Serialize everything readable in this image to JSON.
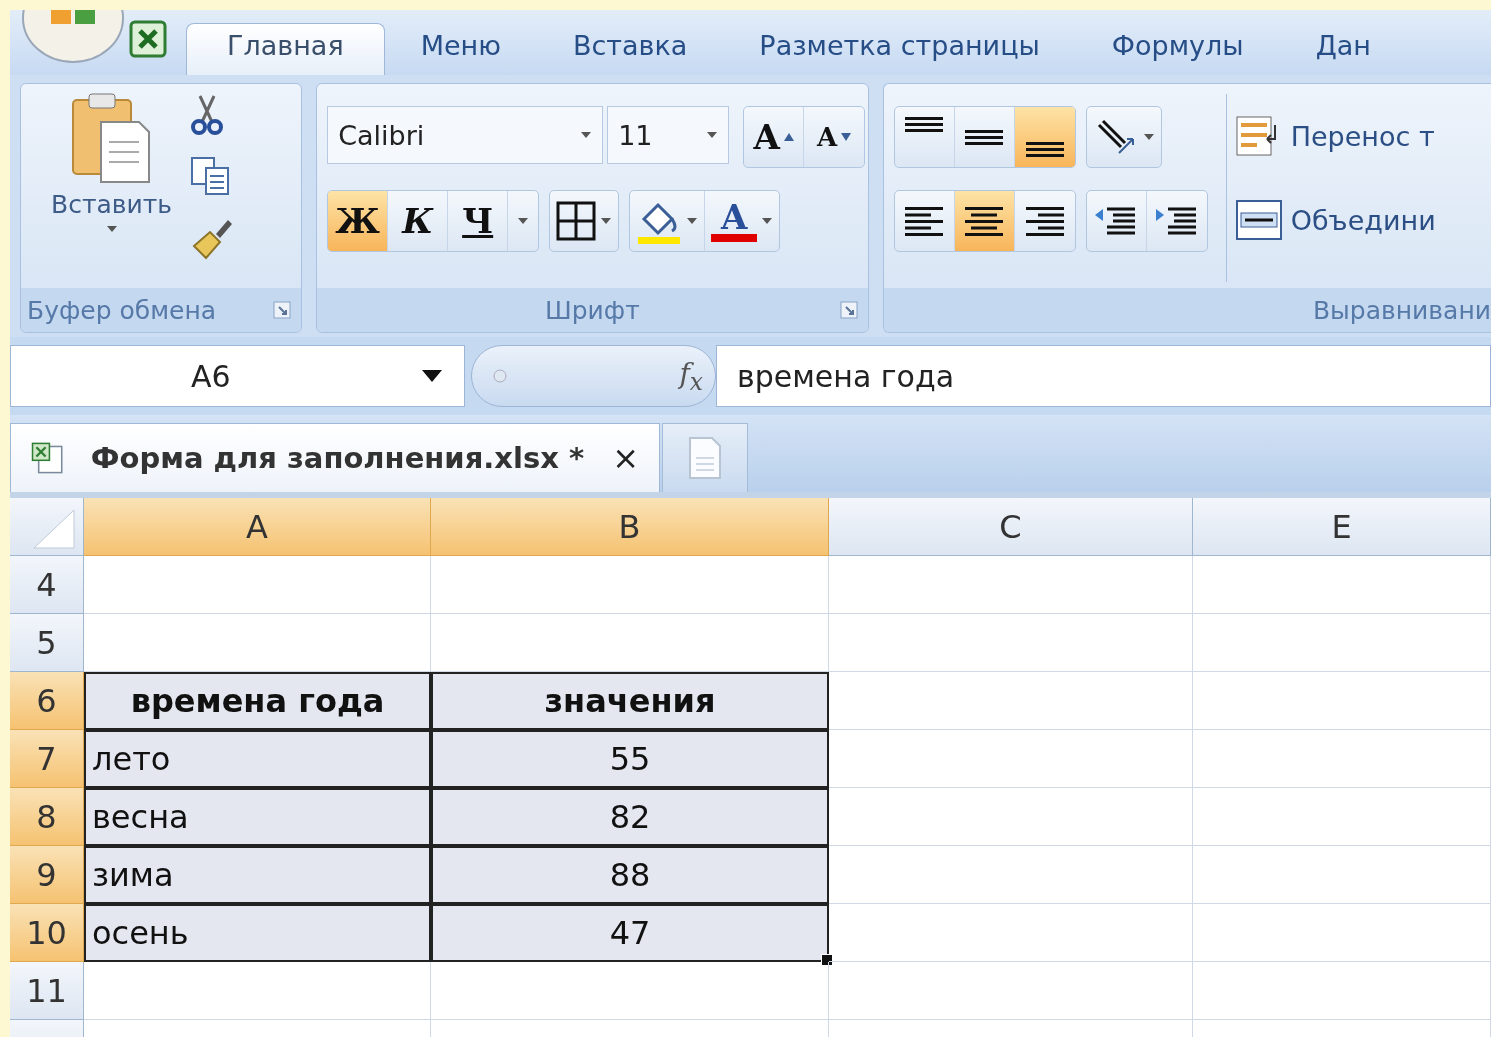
{
  "tabs": [
    {
      "label": "Главная",
      "selected": true
    },
    {
      "label": "Меню",
      "selected": false
    },
    {
      "label": "Вставка",
      "selected": false
    },
    {
      "label": "Разметка страницы",
      "selected": false
    },
    {
      "label": "Формулы",
      "selected": false
    },
    {
      "label": "Дан",
      "selected": false
    }
  ],
  "clipboard": {
    "paste_label": "Вставить",
    "group_label": "Буфер обмена"
  },
  "font": {
    "font_name": "Calibri",
    "font_size": "11",
    "grow_label": "A",
    "shrink_label": "A",
    "styles": [
      {
        "label": "Ж",
        "kind": "bold",
        "selected": true
      },
      {
        "label": "К",
        "kind": "italic",
        "selected": false
      },
      {
        "label": "Ч",
        "kind": "underline",
        "selected": false
      }
    ],
    "color_label": "A",
    "group_label": "Шрифт"
  },
  "alignment": {
    "vertical": [
      {
        "kind": "top",
        "selected": false
      },
      {
        "kind": "middle",
        "selected": false
      },
      {
        "kind": "bottom",
        "selected": true
      }
    ],
    "horizontal": [
      {
        "kind": "left",
        "selected": false
      },
      {
        "kind": "center",
        "selected": true
      },
      {
        "kind": "right",
        "selected": false
      }
    ],
    "wrap_label": "Перенос т",
    "merge_label": "Объедини",
    "group_label": "Выравнивани"
  },
  "formula_bar": {
    "name_box": "А6",
    "function_label": "f$_{x}$",
    "formula": "времена года"
  },
  "document_tab": {
    "title": "Форма для заполнения.xlsx *",
    "close": "×"
  },
  "sheet": {
    "columns": [
      {
        "label": "A",
        "selected": true
      },
      {
        "label": "B",
        "selected": true
      },
      {
        "label": "C",
        "selected": false
      },
      {
        "label": "E",
        "selected": false
      }
    ],
    "rows": [
      {
        "number": "4",
        "selected": false,
        "kind": "empty"
      },
      {
        "number": "5",
        "selected": false,
        "kind": "empty"
      },
      {
        "number": "6",
        "selected": true,
        "kind": "header",
        "cells": [
          "времена года",
          "значения"
        ]
      },
      {
        "number": "7",
        "selected": true,
        "kind": "data",
        "cells": [
          "лето",
          "55"
        ]
      },
      {
        "number": "8",
        "selected": true,
        "kind": "data",
        "cells": [
          "весна",
          "82"
        ]
      },
      {
        "number": "9",
        "selected": true,
        "kind": "data",
        "cells": [
          "зима",
          "88"
        ]
      },
      {
        "number": "10",
        "selected": true,
        "kind": "data",
        "cells": [
          "осень",
          "47"
        ]
      },
      {
        "number": "11",
        "selected": false,
        "kind": "empty"
      }
    ]
  }
}
